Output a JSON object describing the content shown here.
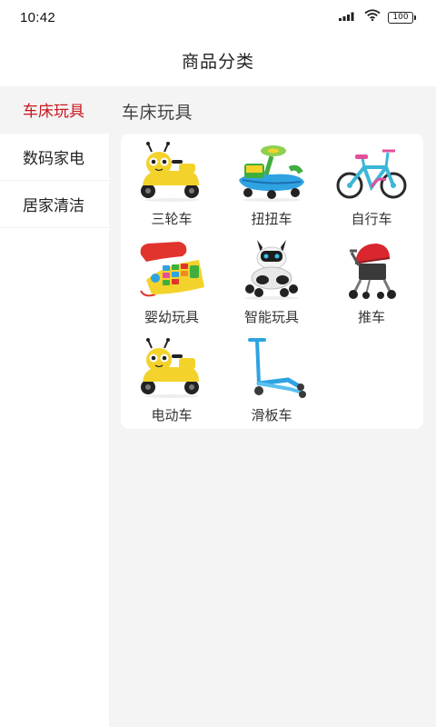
{
  "status": {
    "time": "10:42",
    "battery": "100"
  },
  "header": {
    "title": "商品分类"
  },
  "sidebar": {
    "items": [
      {
        "label": "车床玩具"
      },
      {
        "label": "数码家电"
      },
      {
        "label": "居家清洁"
      }
    ]
  },
  "main": {
    "section_title": "车床玩具",
    "products": [
      {
        "label": "三轮车",
        "icon": "tricycle-icon"
      },
      {
        "label": "扭扭车",
        "icon": "swing-car-icon"
      },
      {
        "label": "自行车",
        "icon": "bicycle-icon"
      },
      {
        "label": "婴幼玩具",
        "icon": "toy-phone-icon"
      },
      {
        "label": "智能玩具",
        "icon": "robot-dog-icon"
      },
      {
        "label": "推车",
        "icon": "stroller-icon"
      },
      {
        "label": "电动车",
        "icon": "electric-car-icon"
      },
      {
        "label": "滑板车",
        "icon": "scooter-icon"
      }
    ]
  },
  "colors": {
    "accent": "#c8171f",
    "panel_bg": "#f4f4f4"
  }
}
